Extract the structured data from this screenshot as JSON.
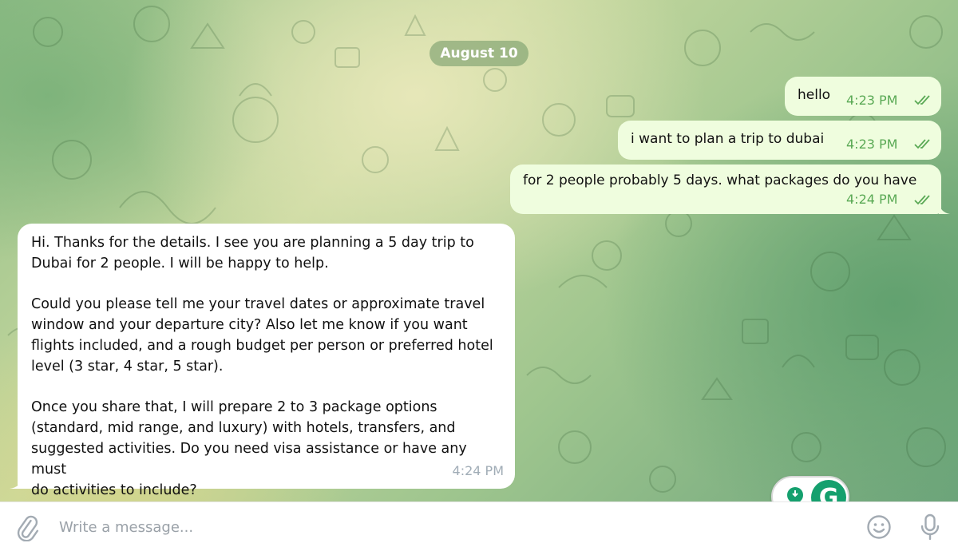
{
  "chat": {
    "date_separator": "August 10",
    "outgoing": [
      {
        "text": "hello",
        "time": "4:23 PM",
        "status": "read"
      },
      {
        "text": "i want to plan a trip to dubai",
        "time": "4:23 PM",
        "status": "read"
      },
      {
        "text": "for 2 people probably 5 days. what packages do you have",
        "time": "4:24 PM",
        "status": "read"
      }
    ],
    "incoming": {
      "paragraphs": [
        "Hi. Thanks for the details. I see you are planning a 5 day trip to\nDubai for 2 people. I will be happy to help.",
        "Could you please tell me your travel dates or approximate travel\nwindow and your departure city? Also let me know if you want\nflights included, and a rough budget per person or preferred hotel\nlevel (3 star, 4 star, 5 star).",
        "Once you share that, I will prepare 2 to 3 package options\n(standard, mid range, and luxury) with hotels, transfers, and\nsuggested activities. Do you need visa assistance or have any must\ndo activities to include?"
      ],
      "time": "4:24 PM"
    }
  },
  "composer": {
    "placeholder": "Write a message...",
    "value": ""
  },
  "grammarly": {
    "logo_letter": "G"
  },
  "icons": {
    "attach": "paperclip-icon",
    "emoji": "smiley-icon",
    "mic": "microphone-icon",
    "read_status": "double-check-icon",
    "grammarly_suggest": "lightbulb-icon"
  },
  "colors": {
    "outgoing_bubble": "#effdde",
    "incoming_bubble": "#ffffff",
    "outgoing_time": "#5aa955",
    "incoming_time": "#a0acb6",
    "grammarly_green": "#15a06e"
  }
}
